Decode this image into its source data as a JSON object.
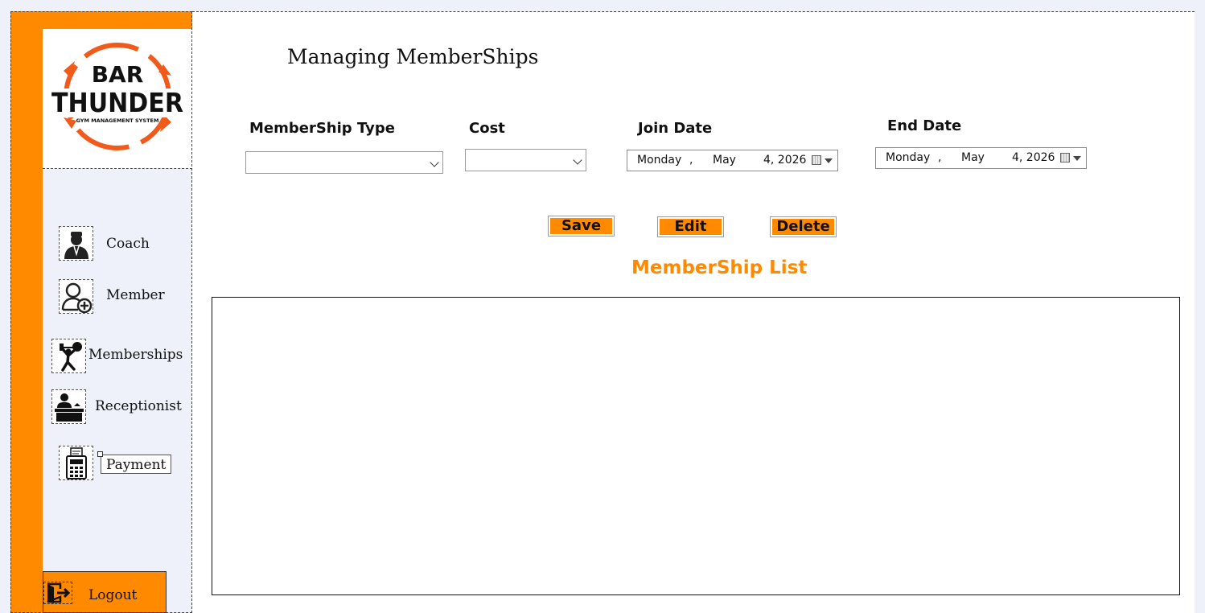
{
  "logo": {
    "line1": "BAR",
    "line2": "THUNDER",
    "tagline": "GYM MANAGEMENT SYSTEM"
  },
  "sidebar": {
    "items": [
      {
        "label": "Coach",
        "icon": "coach-icon"
      },
      {
        "label": "Member",
        "icon": "member-add-icon"
      },
      {
        "label": "Memberships",
        "icon": "weightlifter-icon"
      },
      {
        "label": "Receptionist",
        "icon": "receptionist-icon"
      },
      {
        "label": "Payment",
        "icon": "cash-register-icon"
      }
    ],
    "logout": {
      "label": "Logout",
      "icon": "logout-door-icon"
    }
  },
  "form": {
    "title": "Managing MemberShips",
    "membership_type": {
      "label": "MemberShip Type",
      "value": ""
    },
    "cost": {
      "label": "Cost",
      "value": ""
    },
    "join_date": {
      "label": "Join Date",
      "day": "Monday",
      "sep": ",",
      "month": "May",
      "date": "4, 2026"
    },
    "end_date": {
      "label": "End Date",
      "day": "Monday",
      "sep": ",",
      "month": "May",
      "date": "4, 2026"
    }
  },
  "buttons": {
    "save": "Save",
    "edit": "Edit",
    "delete": "Delete"
  },
  "list": {
    "title": "MemberShip List",
    "rows": []
  },
  "colors": {
    "accent": "#ff8a00",
    "panel": "#eef0fa",
    "text": "#111111"
  }
}
